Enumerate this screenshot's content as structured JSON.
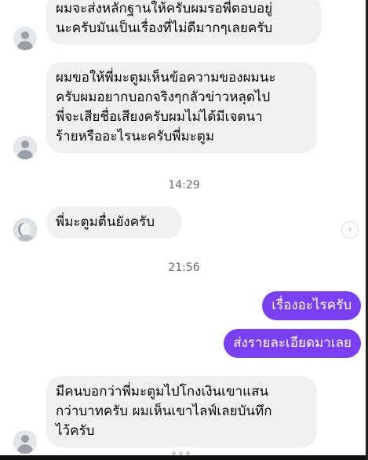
{
  "messages": {
    "m1": "ผมจะส่งหลักฐานให้ครับผมรอพี่ตอบอยู่\nนะครับมันเป็นเรื่องที่ไม่ดีมากๆเลยครับ",
    "m2": "ผมขอให้พี่มะตูมเห็นข้อความของผมนะ\nครับผมอยากบอกจริงๆกลัวข่าวหลุดไป\nพี่จะเสียชื่อเสียงครับผมไม่ได้มีเจตนา\nร้ายหรืออะไรนะครับพี่มะตูม",
    "m3": "พี่มะตูมตื่นยังครับ",
    "m4": "เรื่องอะไรครับ",
    "m5": "ส่งรายละเอียดมาเลย",
    "m6": "มีคนบอกว่าพี่มะตูมไปโกงเงินเขาแสน\nกว่าบาทครับ ผมเห็นเขาไลฟ์เลยบันทึก\nไว้ครับ"
  },
  "timestamps": {
    "t1": "14:29",
    "t2": "21:56"
  },
  "icons": {
    "reaction": "chevron-right-icon",
    "avatar": "user-avatar-icon"
  },
  "colors": {
    "outgoing_bubble": "#7b3ff2",
    "incoming_bubble": "#f0f0f0"
  }
}
